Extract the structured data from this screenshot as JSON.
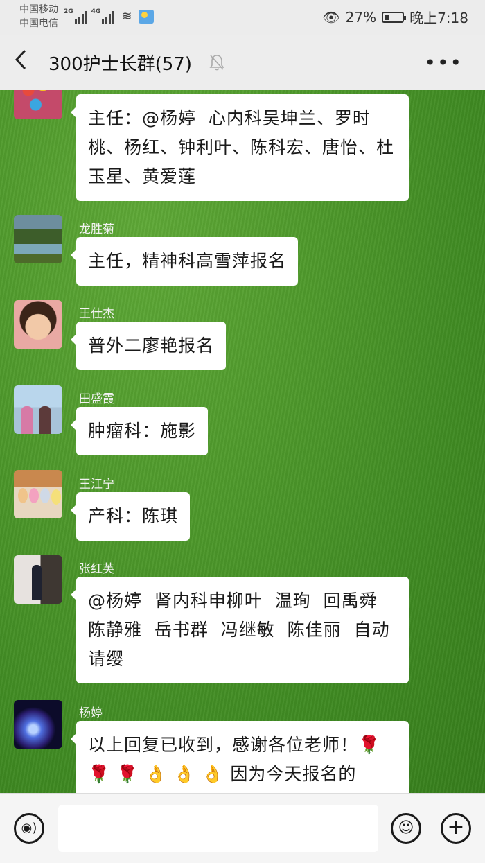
{
  "status": {
    "carrier1": "中国移动",
    "carrier2": "中国电信",
    "net1": "2G",
    "net2": "4G",
    "battery": "27%",
    "battery_level": 0.27,
    "time": "晚上7:18"
  },
  "header": {
    "title": "300护士长群(57)",
    "back_icon": "chevron-left",
    "mute_icon": "bell-off",
    "more_icon": "more-dots",
    "more": "•••"
  },
  "messages": [
    {
      "sender": "",
      "text": "主任：@杨婷  心内科吴坤兰、罗时桃、杨红、钟利叶、陈科宏、唐怡、杜玉星、黄爱莲"
    },
    {
      "sender": "龙胜菊",
      "text": "主任，精神科高雪萍报名"
    },
    {
      "sender": "王仕杰",
      "text": "普外二廖艳报名"
    },
    {
      "sender": "田盛霞",
      "text": "肿瘤科：施影"
    },
    {
      "sender": "王江宁",
      "text": "产科：陈琪"
    },
    {
      "sender": "张红英",
      "text": "@杨婷  肾内科申柳叶  温珣  回禹舜  陈静雅  岳书群  冯继敏  陈佳丽  自动请缨"
    },
    {
      "sender": "杨婷",
      "text": "以上回复已收到，感谢各位老师！🌹 🌹 🌹 👌 👌 👌 因为今天报名的"
    }
  ],
  "input": {
    "value": "",
    "voice_icon": "voice",
    "emoji_icon": "smiley",
    "plus_icon": "plus"
  },
  "colors": {
    "bubble": "#ffffff",
    "topbar": "#ededed",
    "grass": "#4f9a2c"
  }
}
